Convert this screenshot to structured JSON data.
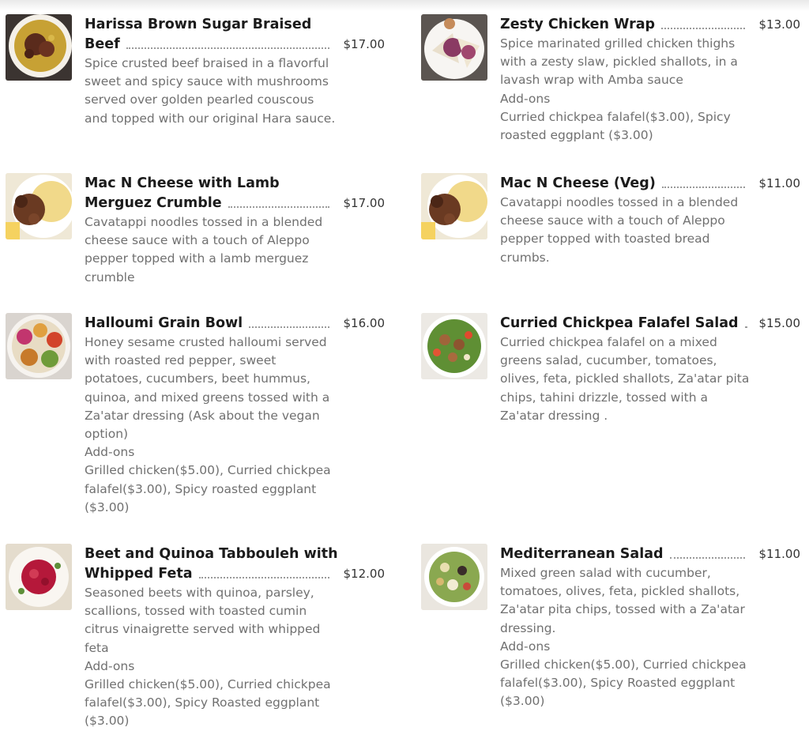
{
  "items": [
    {
      "name_line1": "Harissa Brown Sugar Braised",
      "name_line2": "Beef",
      "price": "$17.00",
      "description": "Spice crusted beef braised in a flavorful sweet and spicy sauce with mushrooms served over golden pearled couscous and topped with our original Hara sauce.",
      "thumb_icon": "beef-couscous-photo"
    },
    {
      "name_line1": "",
      "name_line2": "Zesty Chicken Wrap",
      "price": "$13.00",
      "description": "Spice marinated grilled chicken thighs with a zesty slaw, pickled shallots, in a lavash wrap with Amba sauce",
      "addons_label": "Add-ons",
      "addons": "Curried chickpea falafel($3.00), Spicy roasted eggplant ($3.00)",
      "thumb_icon": "chicken-wrap-photo"
    },
    {
      "name_line1": "Mac N Cheese with Lamb",
      "name_line2": "Merguez Crumble",
      "price": "$17.00",
      "description": "Cavatappi noodles tossed in a blended cheese sauce with a touch of Aleppo pepper topped with a lamb merguez crumble",
      "thumb_icon": "mac-lamb-photo"
    },
    {
      "name_line1": "",
      "name_line2": "Mac N Cheese (Veg)",
      "price": "$11.00",
      "description": "Cavatappi noodles tossed in a blended cheese sauce with a touch of Aleppo pepper topped with toasted bread crumbs.",
      "thumb_icon": "mac-veg-photo"
    },
    {
      "name_line1": "",
      "name_line2": "Halloumi Grain Bowl",
      "price": "$16.00",
      "description": "Honey sesame crusted halloumi served with roasted red pepper, sweet potatoes, cucumbers, beet hummus, quinoa, and mixed greens tossed with a Za'atar dressing (Ask about the vegan option)",
      "addons_label": "Add-ons",
      "addons": "Grilled chicken($5.00), Curried chickpea falafel($3.00), Spicy roasted eggplant ($3.00)",
      "thumb_icon": "grain-bowl-photo"
    },
    {
      "name_line1": "",
      "name_line2": "Curried Chickpea Falafel Salad",
      "price": "$15.00",
      "description": "Curried chickpea falafel on a mixed greens salad, cucumber, tomatoes, olives, feta, pickled shallots, Za'atar pita chips, tahini drizzle,  tossed with a Za'atar dressing .",
      "thumb_icon": "falafel-salad-photo"
    },
    {
      "name_line1": "Beet and Quinoa Tabbouleh with",
      "name_line2": "Whipped Feta",
      "price": "$12.00",
      "description": "Seasoned beets with quinoa, parsley, scallions, tossed with toasted cumin citrus vinaigrette served with whipped feta",
      "addons_label": "Add-ons",
      "addons": "Grilled chicken($5.00), Curried chickpea falafel($3.00), Spicy Roasted eggplant ($3.00)",
      "thumb_icon": "beet-tabbouleh-photo"
    },
    {
      "name_line1": "",
      "name_line2": "Mediterranean Salad",
      "price": "$11.00",
      "description": "Mixed green salad with cucumber, tomatoes, olives, feta, pickled shallots, Za'atar pita chips, tossed with a Za'atar dressing.",
      "addons_label": "Add-ons",
      "addons": "Grilled chicken($5.00), Curried chickpea falafel($3.00), Spicy Roasted eggplant ($3.00)",
      "thumb_icon": "mediterranean-salad-photo"
    }
  ]
}
